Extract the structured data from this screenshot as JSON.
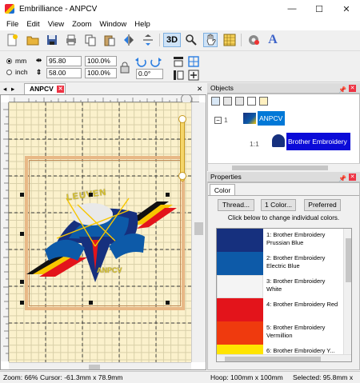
{
  "window": {
    "title": "Embrilliance - ANPCV",
    "controls": [
      "—",
      "☐",
      "✕"
    ]
  },
  "menu": [
    "File",
    "Edit",
    "View",
    "Zoom",
    "Window",
    "Help"
  ],
  "toolbar": {
    "icons": [
      "new-icon",
      "open-icon",
      "save-icon",
      "print-icon",
      "copy-icon",
      "paste-icon",
      "flip-horizontal-icon",
      "flip-vertical-icon",
      "3d-view-icon",
      "zoom-icon",
      "select-hand-icon",
      "grid-icon",
      "stitch-settings-icon",
      "text-tool-icon"
    ],
    "label_3d": "3D",
    "label_text": "A"
  },
  "units": {
    "mm_label": "mm",
    "inch_label": "inch",
    "selected": "mm"
  },
  "size": {
    "width_value": "95.80",
    "height_value": "58.00",
    "width_percent": "100.0%",
    "height_percent": "100.0%",
    "rotation": "0.0°"
  },
  "document_tab": {
    "label": "ANPCV"
  },
  "objects_panel": {
    "title": "Objects",
    "items": [
      {
        "prefix": "1",
        "label": "ANPCV"
      },
      {
        "prefix": "1:1",
        "label": "Brother Embroidery"
      }
    ]
  },
  "properties_panel": {
    "title": "Properties",
    "tab": "Color",
    "buttons": {
      "thread": "Thread...",
      "one_color": "1 Color...",
      "preferred": "Preferred"
    },
    "hint": "Click below to change individual colors.",
    "colors": [
      {
        "label": "1: Brother Embroidery Prussian Blue",
        "hex": "#16307e"
      },
      {
        "label": "2: Brother Embroidery Electric Blue",
        "hex": "#0d5aa8"
      },
      {
        "label": "3: Brother Embroidery White",
        "hex": "#f4f4f4"
      },
      {
        "label": "4: Brother Embroidery Red",
        "hex": "#e3141b"
      },
      {
        "label": "5: Brother Embroidery Vermillion",
        "hex": "#ef3a0e"
      },
      {
        "label": "6: Brother Embroidery Y...",
        "hex": "#ffe400"
      }
    ]
  },
  "status": {
    "zoom": "Zoom: 66%",
    "cursor": "Cursor: -61.3mm x 78.9mm",
    "hoop": "Hoop: 100mm x 100mm",
    "selected": "Selected: 95.8mm x"
  },
  "design": {
    "top_text": "LEUVEN",
    "bottom_text": "ANPCV",
    "accent_colors": [
      "#16307e",
      "#0d5aa8",
      "#e3141b",
      "#f7c600",
      "#111111"
    ]
  }
}
